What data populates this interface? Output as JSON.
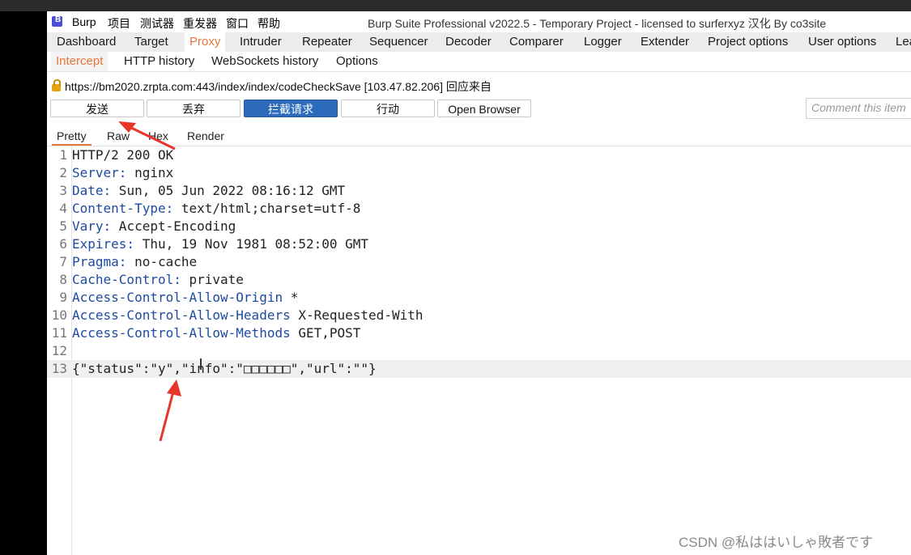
{
  "window": {
    "app_name": "Burp",
    "title": "Burp Suite Professional v2022.5 - Temporary Project - licensed to surferxyz 汉化 By co3site",
    "menu": [
      "项目",
      "测试器",
      "重发器",
      "窗口",
      "帮助"
    ]
  },
  "main_tabs": [
    "Dashboard",
    "Target",
    "Proxy",
    "Intruder",
    "Repeater",
    "Sequencer",
    "Decoder",
    "Comparer",
    "Logger",
    "Extender",
    "Project options",
    "User options",
    "Lea"
  ],
  "main_tab_active": "Proxy",
  "sub_tabs": [
    "Intercept",
    "HTTP history",
    "WebSockets history",
    "Options"
  ],
  "sub_tab_active": "Intercept",
  "request_info": "https://bm2020.zrpta.com:443/index/index/codeCheckSave  [103.47.82.206] 回应来自",
  "buttons": {
    "send": "发送",
    "drop": "丢弃",
    "intercept": "拦截请求",
    "action": "行动",
    "open_browser": "Open Browser"
  },
  "comment_placeholder": "Comment this item",
  "view_tabs": [
    "Pretty",
    "Raw",
    "Hex",
    "Render"
  ],
  "view_tab_active": "Pretty",
  "response_lines": [
    {
      "n": "1",
      "key": "HTTP/2 200 OK",
      "val": ""
    },
    {
      "n": "2",
      "key": "Server:",
      "val": " nginx"
    },
    {
      "n": "3",
      "key": "Date:",
      "val": " Sun, 05 Jun 2022 08:16:12 GMT"
    },
    {
      "n": "4",
      "key": "Content-Type:",
      "val": " text/html;charset=utf-8"
    },
    {
      "n": "5",
      "key": "Vary:",
      "val": " Accept-Encoding"
    },
    {
      "n": "6",
      "key": "Expires:",
      "val": " Thu, 19 Nov 1981 08:52:00 GMT"
    },
    {
      "n": "7",
      "key": "Pragma:",
      "val": " no-cache"
    },
    {
      "n": "8",
      "key": "Cache-Control:",
      "val": " private"
    },
    {
      "n": "9",
      "key": "Access-Control-Allow-Origin",
      "val": " *"
    },
    {
      "n": "10",
      "key": "Access-Control-Allow-Headers",
      "val": " X-Requested-With"
    },
    {
      "n": "11",
      "key": "Access-Control-Allow-Methods",
      "val": " GET,POST"
    },
    {
      "n": "12",
      "key": "",
      "val": ""
    },
    {
      "n": "13",
      "key": "",
      "val": "{\"status\":\"y\",\"info\":\"□□□□□□\",\"url\":\"\"}"
    }
  ],
  "watermark": "CSDN @私ははいしゃ敗者です",
  "colors": {
    "accent": "#e8743b",
    "primary_button": "#2d6bbd",
    "arrow": "#e8352a"
  }
}
